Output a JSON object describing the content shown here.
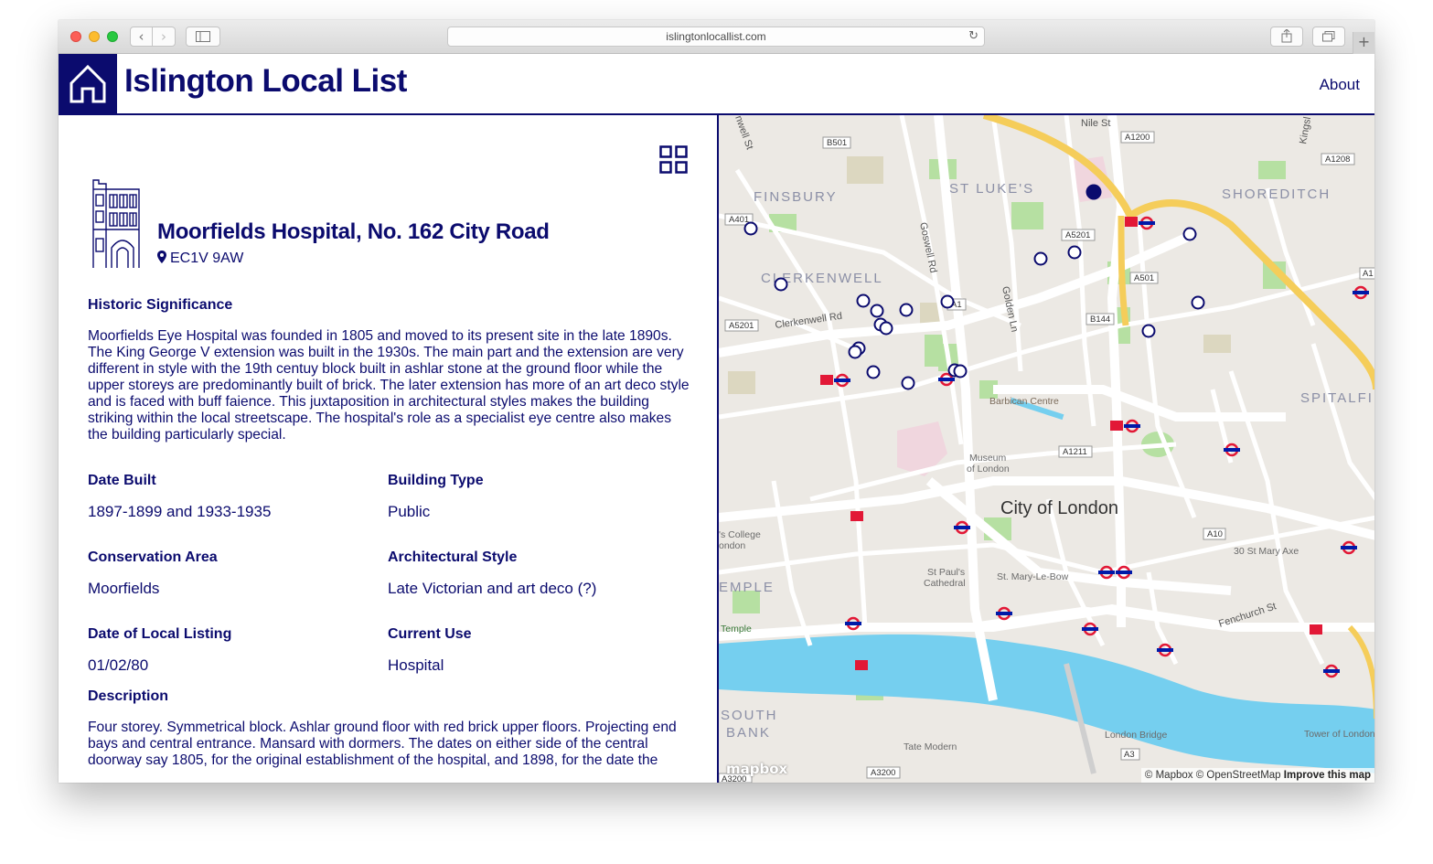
{
  "browser": {
    "url": "islingtonlocallist.com",
    "icons": {
      "back": "chevron-left-icon",
      "forward": "chevron-right-icon",
      "sidebar": "sidebar-icon",
      "reload": "reload-icon",
      "share": "share-icon",
      "tabs": "tabs-icon",
      "new_tab": "plus-icon"
    }
  },
  "header": {
    "title": "Islington Local List",
    "about": "About",
    "logo_icon": "house-icon",
    "brand_color": "#0b0b6e"
  },
  "entry": {
    "title": "Moorfields Hospital, No. 162 City Road",
    "postcode": "EC1V 9AW",
    "significance_label": "Historic Significance",
    "significance_text": "Moorfields Eye Hospital was founded in 1805 and moved to its present site in the late 1890s. The King George V extension was built in the 1930s. The main part and the extension are very different in style with the 19th centuy block built in ashlar stone at the ground floor while the upper storeys are predominantly built of brick. The later extension has more of an art deco style and is faced with buff faience. This juxtaposition in architectural styles makes the building striking within the local streetscape. The hospital's role as a specialist eye centre also makes the building particularly special.",
    "fields": {
      "date_built_label": "Date Built",
      "date_built": "1897-1899 and 1933-1935",
      "building_type_label": "Building Type",
      "building_type": "Public",
      "conservation_area_label": "Conservation Area",
      "conservation_area": "Moorfields",
      "architectural_style_label": "Architectural Style",
      "architectural_style": "Late Victorian and art deco (?)",
      "date_listing_label": "Date of Local Listing",
      "date_listing": "01/02/80",
      "current_use_label": "Current Use",
      "current_use": "Hospital"
    },
    "description_label": "Description",
    "description_text": "Four storey. Symmetrical block. Ashlar ground floor with red brick upper floors. Projecting end bays and central entrance. Mansard with dormers. The dates on either side of the central doorway say 1805, for the original establishment of the hospital, and 1898, for the date the"
  },
  "map": {
    "areas": [
      "FINSBURY",
      "ST LUKE'S",
      "SHOREDITCH",
      "CLERKENWELL",
      "SPITALFI",
      "City of London",
      "EMPLE",
      "SOUTH",
      "BANK"
    ],
    "streets": [
      "Nile St",
      "Goswell Rd",
      "Golden Ln",
      "Clerkenwell Rd",
      "Fenchurch St",
      "Kingsl",
      "nwell St"
    ],
    "road_shields": [
      "B501",
      "A1200",
      "A1208",
      "A401",
      "A5201",
      "A5201",
      "A501",
      "B144",
      "A1",
      "A1",
      "A1211",
      "A10",
      "A3",
      "A3200",
      "A3200"
    ],
    "pois": [
      "Barbican Centre",
      "Museum",
      "of London",
      "St Paul's",
      "Cathedral",
      "St. Mary-Le-Bow",
      "30 St Mary Axe",
      "London Bridge",
      "Tate Modern",
      "Tower of London",
      "'s College",
      "ondon",
      "Temple"
    ],
    "attribution_mapbox": "© Mapbox",
    "attribution_osm": "© OpenStreetMap",
    "improve": "Improve this map",
    "logo": "mapbox",
    "water_color": "#75cfef",
    "marker_color": "#0b0b6e"
  }
}
